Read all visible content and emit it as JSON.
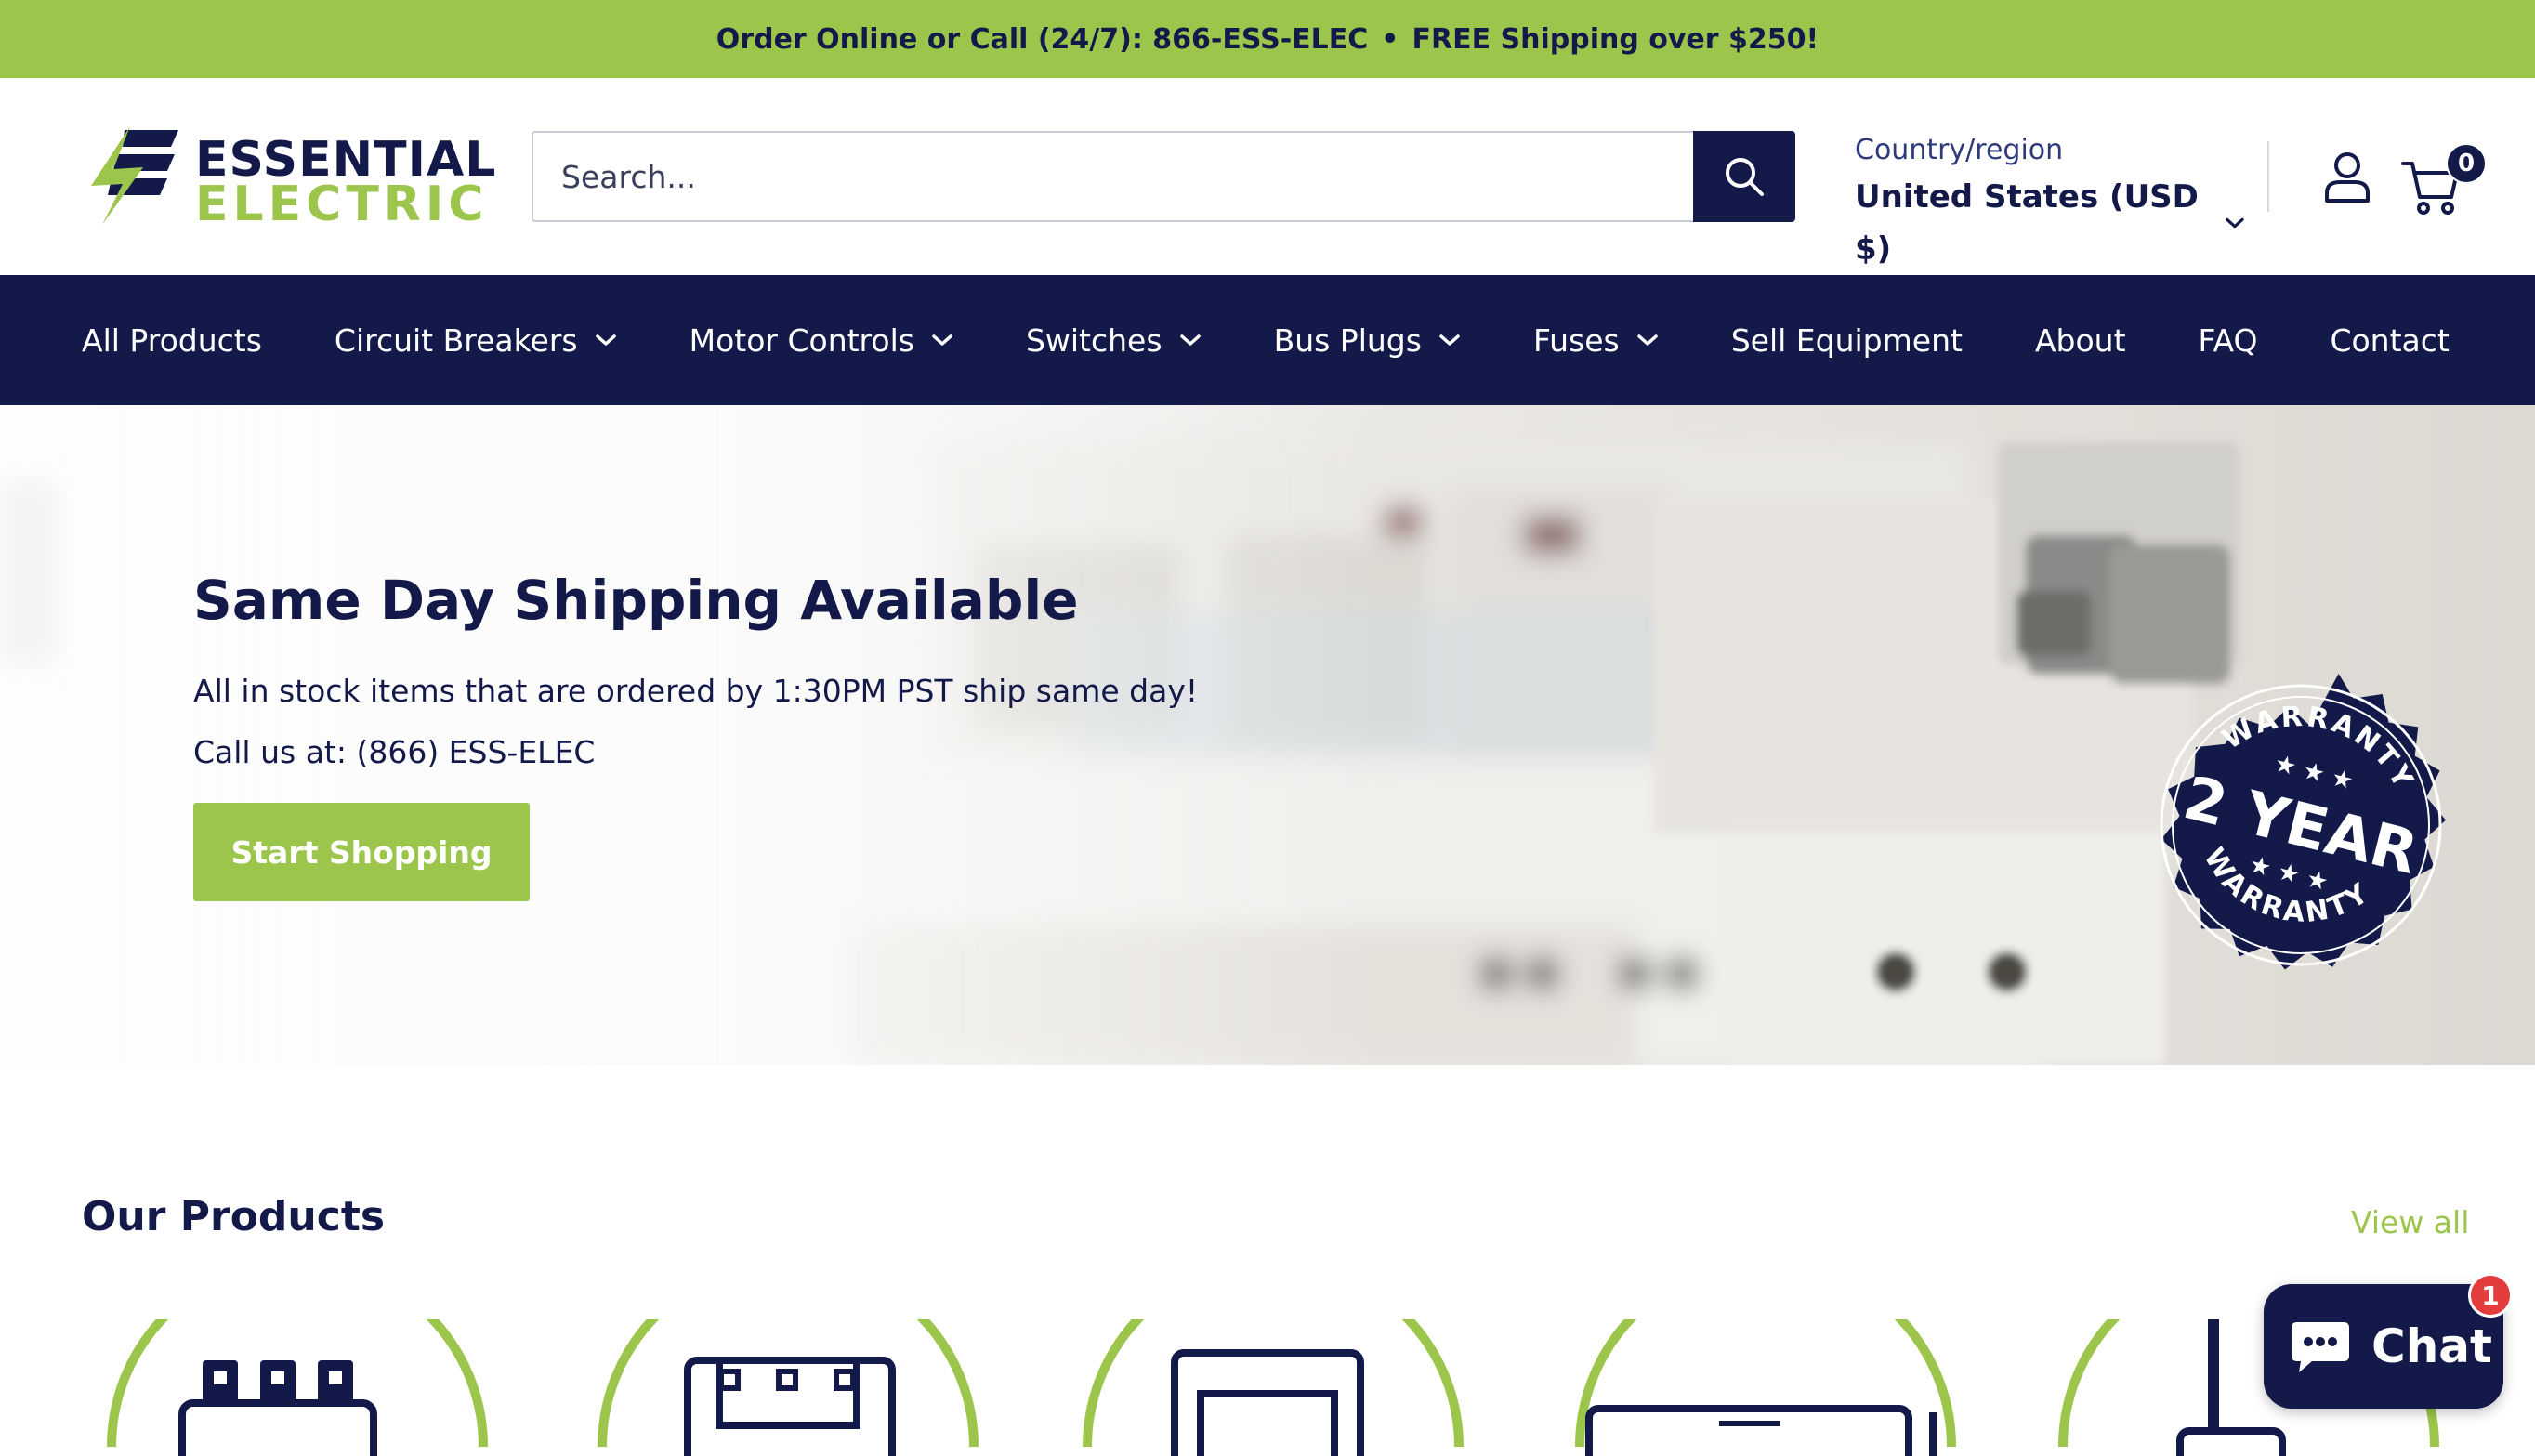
{
  "announcement": {
    "part1": "Order Online or Call (24/7): 866-ESS-ELEC",
    "separator": "•",
    "part2": "FREE Shipping over $250!"
  },
  "brand": {
    "name_line1": "ESSENTIAL",
    "name_line2": "ELECTRIC",
    "colors": {
      "navy": "#131a4a",
      "green": "#9cc54c"
    }
  },
  "search": {
    "placeholder": "Search...",
    "value": "",
    "button_icon": "search-icon"
  },
  "country": {
    "label": "Country/region",
    "value": "United States (USD $)"
  },
  "header_icons": {
    "account": "user-icon",
    "cart": "cart-icon"
  },
  "cart": {
    "count": "0"
  },
  "nav": {
    "items": [
      {
        "label": "All Products",
        "dropdown": false
      },
      {
        "label": "Circuit Breakers",
        "dropdown": true
      },
      {
        "label": "Motor Controls",
        "dropdown": true
      },
      {
        "label": "Switches",
        "dropdown": true
      },
      {
        "label": "Bus Plugs",
        "dropdown": true
      },
      {
        "label": "Fuses",
        "dropdown": true
      },
      {
        "label": "Sell Equipment",
        "dropdown": false
      },
      {
        "label": "About",
        "dropdown": false
      },
      {
        "label": "FAQ",
        "dropdown": false
      },
      {
        "label": "Contact",
        "dropdown": false
      }
    ]
  },
  "hero": {
    "title": "Same Day Shipping Available",
    "line1": "All in stock items that are ordered by 1:30PM PST ship same day!",
    "line2": "Call us at: (866) ESS-ELEC",
    "cta": "Start Shopping",
    "seal": {
      "top": "WARRANTY",
      "middle": "2 YEAR",
      "bottom": "WARRANTY"
    }
  },
  "products": {
    "title": "Our Products",
    "view_all": "View all"
  },
  "chat": {
    "label": "Chat",
    "badge": "1"
  }
}
